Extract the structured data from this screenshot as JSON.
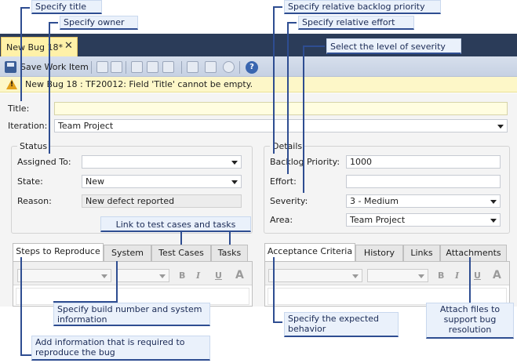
{
  "tab": {
    "title": "New Bug 18*",
    "close_glyph": "✕"
  },
  "toolbar": {
    "save_label": "Save Work Item",
    "help_glyph": "?"
  },
  "infobar": {
    "message": "New Bug 18 : TF20012: Field 'Title' cannot be empty.",
    "icon_glyph": "!"
  },
  "form": {
    "title_label": "Title:",
    "title_value": "",
    "iteration_label": "Iteration:",
    "iteration_value": "Team Project",
    "status_group": "Status",
    "assigned_label": "Assigned To:",
    "assigned_value": "",
    "state_label": "State:",
    "state_value": "New",
    "reason_label": "Reason:",
    "reason_value": "New defect reported",
    "details_group": "Details",
    "backlog_label": "Backlog Priority:",
    "backlog_value": "1000",
    "effort_label": "Effort:",
    "effort_value": "",
    "severity_label": "Severity:",
    "severity_value": "3 - Medium",
    "area_label": "Area:",
    "area_value": "Team Project"
  },
  "left_tabs": [
    "Steps to Reproduce",
    "System",
    "Test Cases",
    "Tasks"
  ],
  "right_tabs": [
    "Acceptance Criteria",
    "History",
    "Links",
    "Attachments"
  ],
  "rte": {
    "bold": "B",
    "italic": "I",
    "underline": "U",
    "font_color": "A"
  },
  "callouts": {
    "title": "Specify title",
    "owner": "Specify owner",
    "backlog": "Specify relative backlog priority",
    "effort": "Specify relative effort",
    "severity": "Select the level of severity",
    "links": "Link to test cases and tasks",
    "system_1": "Specify build number and system",
    "system_2": "information",
    "steps_1": "Add information that is required to",
    "steps_2": "reproduce the bug",
    "expected_1": "Specify the expected",
    "expected_2": "behavior",
    "attach_1": "Attach files to",
    "attach_2": "support bug",
    "attach_3": "resolution"
  },
  "colors": {
    "tabstrip": "#2b3c59",
    "active_tab": "#fff1a8",
    "callout_line": "#2e4d91",
    "infobar": "#fdf7c8"
  }
}
